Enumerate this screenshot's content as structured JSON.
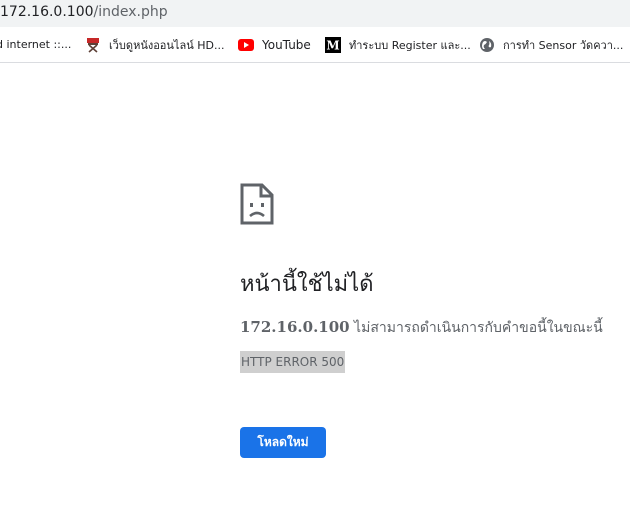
{
  "browser": {
    "url_host": "172.16.0.100",
    "url_path": "/index.php"
  },
  "bookmarks": [
    {
      "label": "d internet ::...",
      "icon": "none"
    },
    {
      "label": "เว็บดูหนังออนไลน์ HD...",
      "icon": "director-chair-icon"
    },
    {
      "label": "YouTube",
      "icon": "youtube-icon"
    },
    {
      "label": "ทำระบบ Register และ...",
      "icon": "medium-m-icon"
    },
    {
      "label": "การทำ Sensor วัดควา...",
      "icon": "globe-icon"
    }
  ],
  "error": {
    "title": "หน้านี้ใช้ไม่ได้",
    "host": "172.16.0.100",
    "message": " ไม่สามารถดำเนินการกับคำขอนี้ในขณะนี้",
    "code": "HTTP ERROR 500",
    "reload_label": "โหลดใหม่"
  },
  "colors": {
    "accent": "#1a73e8",
    "youtube_red": "#ff0000",
    "text_primary": "#202124",
    "text_secondary": "#5f6368"
  }
}
